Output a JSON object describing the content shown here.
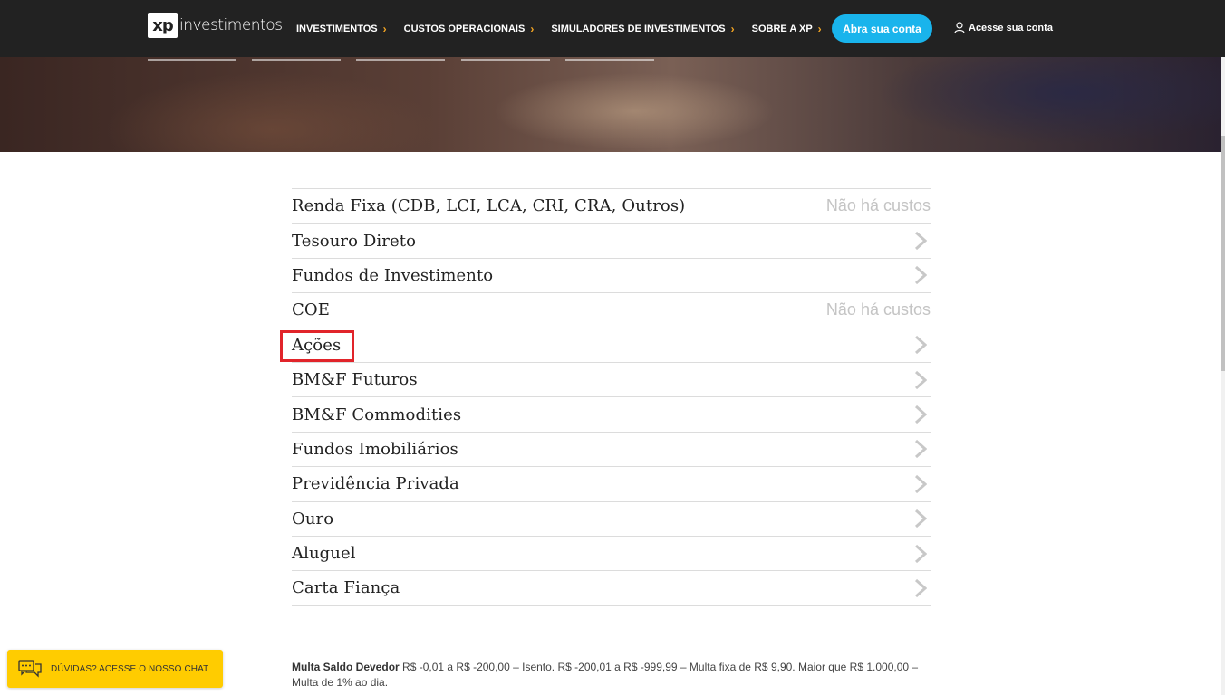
{
  "header": {
    "logo_mark": "xp",
    "logo_text": "investimentos",
    "nav": [
      {
        "label": "INVESTIMENTOS"
      },
      {
        "label": "CUSTOS OPERACIONAIS"
      },
      {
        "label": "SIMULADORES DE INVESTIMENTOS"
      },
      {
        "label": "SOBRE A XP"
      }
    ],
    "cta_label": "Abra sua conta",
    "login_label": "Acesse sua conta"
  },
  "colors": {
    "topbar": "#222222",
    "accent_cyan": "#19b4ec",
    "chevron_orange": "#f5a623",
    "highlight_red": "#e1242a",
    "chat_yellow": "#ffcc00"
  },
  "cost_list": [
    {
      "label": "Renda Fixa (CDB, LCI, LCA, CRI, CRA, Outros)",
      "note": "Não há custos"
    },
    {
      "label": "Tesouro Direto",
      "icon": "chevron-right-icon"
    },
    {
      "label": "Fundos de Investimento",
      "icon": "chevron-right-icon"
    },
    {
      "label": "COE",
      "note": "Não há custos"
    },
    {
      "label": "Ações",
      "icon": "chevron-right-icon",
      "highlighted": true
    },
    {
      "label": "BM&F Futuros",
      "icon": "chevron-right-icon"
    },
    {
      "label": "BM&F Commodities",
      "icon": "chevron-right-icon"
    },
    {
      "label": "Fundos Imobiliários",
      "icon": "chevron-right-icon"
    },
    {
      "label": "Previdência Privada",
      "icon": "chevron-right-icon"
    },
    {
      "label": "Ouro",
      "icon": "chevron-right-icon"
    },
    {
      "label": "Aluguel",
      "icon": "chevron-right-icon"
    },
    {
      "label": "Carta Fiança",
      "icon": "chevron-right-icon"
    }
  ],
  "footnote": {
    "title": "Multa Saldo Devedor",
    "text": "R$ -0,01 a R$ -200,00 – Isento. R$ -200,01 a R$ -999,99 – Multa fixa de R$ 9,90. Maior que R$ 1.000,00 – Multa de 1% ao dia."
  },
  "chat": {
    "label": "DÚVIDAS? ACESSE O NOSSO CHAT",
    "icon": "chat-icon"
  }
}
